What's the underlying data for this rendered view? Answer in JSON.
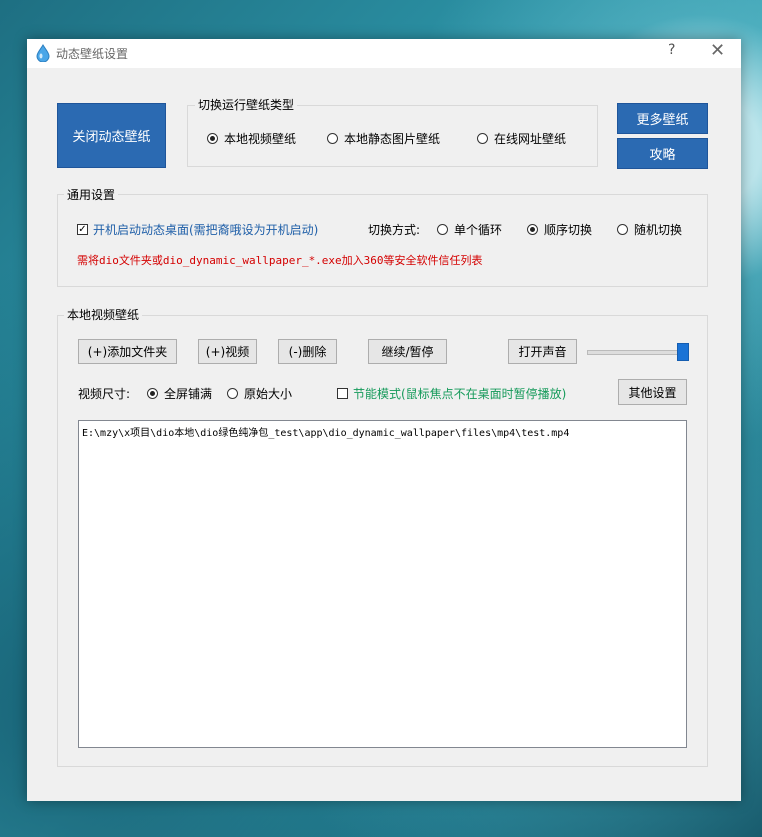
{
  "window": {
    "title": "动态壁纸设置",
    "help": "?",
    "close": "✕"
  },
  "top": {
    "close_wallpaper": "关闭动态壁纸",
    "type_group_label": "切换运行壁纸类型",
    "type_options": [
      {
        "label": "本地视频壁纸",
        "selected": true
      },
      {
        "label": "本地静态图片壁纸",
        "selected": false
      },
      {
        "label": "在线网址壁纸",
        "selected": false
      }
    ],
    "more_wallpapers": "更多壁纸",
    "guide": "攻略"
  },
  "general": {
    "label": "通用设置",
    "autostart": "开机启动动态桌面(需把裔哦设为开机启动)",
    "autostart_checked": true,
    "switch_mode_label": "切换方式:",
    "switch_options": [
      {
        "label": "单个循环",
        "selected": false
      },
      {
        "label": "顺序切换",
        "selected": true
      },
      {
        "label": "随机切换",
        "selected": false
      }
    ],
    "warning": "需将dio文件夹或dio_dynamic_wallpaper_*.exe加入360等安全软件信任列表"
  },
  "local_video": {
    "label": "本地视频壁纸",
    "add_folder": "(+)添加文件夹",
    "add_video": "(+)视频",
    "delete": "(-)删除",
    "continue_pause": "继续/暂停",
    "open_sound": "打开声音",
    "volume_fraction": 1.0,
    "size_label": "视频尺寸:",
    "size_options": [
      {
        "label": "全屏铺满",
        "selected": true
      },
      {
        "label": "原始大小",
        "selected": false
      }
    ],
    "power_saving": "节能模式(鼠标焦点不在桌面时暂停播放)",
    "power_saving_checked": false,
    "other_settings": "其他设置",
    "files": [
      "E:\\mzy\\x项目\\dio本地\\dio绿色纯净包_test\\app\\dio_dynamic_wallpaper\\files\\mp4\\test.mp4"
    ]
  },
  "colors": {
    "primary_button": "#2b6ab2",
    "link_blue": "#1f5fa8",
    "warning_red": "#d40000",
    "green": "#159a5a",
    "slider": "#1a73d6"
  }
}
